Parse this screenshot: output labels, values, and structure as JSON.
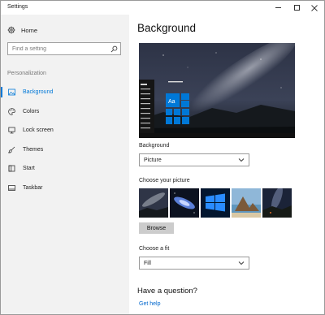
{
  "window": {
    "title": "Settings"
  },
  "sidebar": {
    "home_label": "Home",
    "search_placeholder": "Find a setting",
    "section_label": "Personalization",
    "items": [
      {
        "label": "Background",
        "icon": "picture-icon",
        "active": true
      },
      {
        "label": "Colors",
        "icon": "palette-icon",
        "active": false
      },
      {
        "label": "Lock screen",
        "icon": "lock-screen-icon",
        "active": false
      },
      {
        "label": "Themes",
        "icon": "brush-icon",
        "active": false
      },
      {
        "label": "Start",
        "icon": "start-icon",
        "active": false
      },
      {
        "label": "Taskbar",
        "icon": "taskbar-icon",
        "active": false
      }
    ]
  },
  "main": {
    "title": "Background",
    "preview_sample_text": "Aa",
    "background_label": "Background",
    "background_value": "Picture",
    "choose_picture_label": "Choose your picture",
    "browse_label": "Browse",
    "fit_label": "Choose a fit",
    "fit_value": "Fill",
    "question_title": "Have a question?",
    "help_link": "Get help"
  },
  "colors": {
    "accent": "#0078d7",
    "sidebar_bg": "#f2f2f2",
    "link": "#0066cc"
  }
}
